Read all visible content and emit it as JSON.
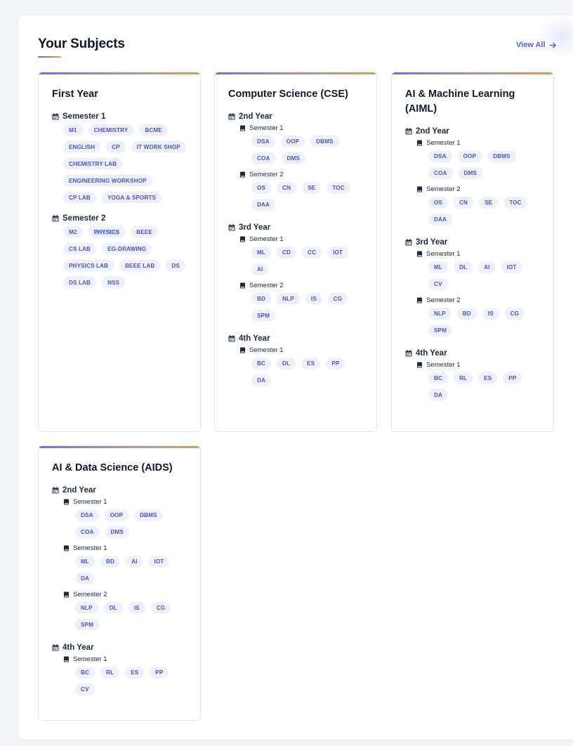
{
  "header": {
    "title": "Your Subjects",
    "view_all": "View All"
  },
  "colors": {
    "accent": "#5b5fd6",
    "chip_bg": "#eef0fb",
    "bar_start": "#7b6be0",
    "bar_end": "#e2a13b"
  },
  "cards": [
    {
      "title": "First Year",
      "groups": [
        {
          "label": "Semester 1",
          "icon": "calendar-icon",
          "chips": [
            "M1",
            "CHEMISTRY",
            "BCME",
            "ENGLISH",
            "CP",
            "IT WORK SHOP",
            "CHEMISTRY LAB",
            "ENGINEERING WORKSHOP",
            "CP LAB",
            "YOGA & SPORTS"
          ]
        },
        {
          "label": "Semester 2",
          "icon": "calendar-icon",
          "chips": [
            "M2",
            "PHYSICS",
            "BEEE",
            "CS LAB",
            "EG-DRAWING",
            "PHYSICS LAB",
            "BEEE LAB",
            "DS",
            "DS LAB",
            "NSS"
          ]
        }
      ]
    },
    {
      "title": "Computer Science (CSE)",
      "years": [
        {
          "label": "2nd Year",
          "sems": [
            {
              "label": "Semester 1",
              "chips": [
                "DSA",
                "OOP",
                "DBMS",
                "COA",
                "DMS"
              ]
            },
            {
              "label": "Semester 2",
              "chips": [
                "OS",
                "CN",
                "SE",
                "TOC",
                "DAA"
              ]
            }
          ]
        },
        {
          "label": "3rd Year",
          "sems": [
            {
              "label": "Semester 1",
              "chips": [
                "ML",
                "CD",
                "CC",
                "IOT",
                "AI"
              ]
            },
            {
              "label": "Semester 2",
              "chips": [
                "BD",
                "NLP",
                "IS",
                "CG",
                "SPM"
              ]
            }
          ]
        },
        {
          "label": "4th Year",
          "sems": [
            {
              "label": "Semester 1",
              "chips": [
                "BC",
                "DL",
                "ES",
                "PP",
                "DA"
              ]
            }
          ]
        }
      ]
    },
    {
      "title": "AI & Machine Learning (AIML)",
      "years": [
        {
          "label": "2nd Year",
          "sems": [
            {
              "label": "Semester 1",
              "chips": [
                "DSA",
                "OOP",
                "DBMS",
                "COA",
                "DMS"
              ]
            },
            {
              "label": "Semester 2",
              "chips": [
                "OS",
                "CN",
                "SE",
                "TOC",
                "DAA"
              ]
            }
          ]
        },
        {
          "label": "3rd Year",
          "sems": [
            {
              "label": "Semester 1",
              "chips": [
                "ML",
                "DL",
                "AI",
                "IOT",
                "CV"
              ]
            },
            {
              "label": "Semester 2",
              "chips": [
                "NLP",
                "BD",
                "IS",
                "CG",
                "SPM"
              ]
            }
          ]
        },
        {
          "label": "4th Year",
          "sems": [
            {
              "label": "Semester 1",
              "chips": [
                "BC",
                "RL",
                "ES",
                "PP",
                "DA"
              ]
            }
          ]
        }
      ]
    },
    {
      "title": "AI & Data Science (AIDS)",
      "years": [
        {
          "label": "2nd Year",
          "sems": [
            {
              "label": "Semester 1",
              "chips": [
                "DSA",
                "OOP",
                "DBMS",
                "COA",
                "DMS"
              ]
            },
            {
              "label": "Semester 1",
              "chips": [
                "ML",
                "BD",
                "AI",
                "IOT",
                "DA"
              ]
            },
            {
              "label": "Semester 2",
              "chips": [
                "NLP",
                "DL",
                "IS",
                "CG",
                "SPM"
              ]
            }
          ]
        },
        {
          "label": "4th Year",
          "sems": [
            {
              "label": "Semester 1",
              "chips": [
                "BC",
                "RL",
                "ES",
                "PP",
                "CV"
              ]
            }
          ]
        }
      ]
    }
  ],
  "selected_chip": "PHYSICS"
}
